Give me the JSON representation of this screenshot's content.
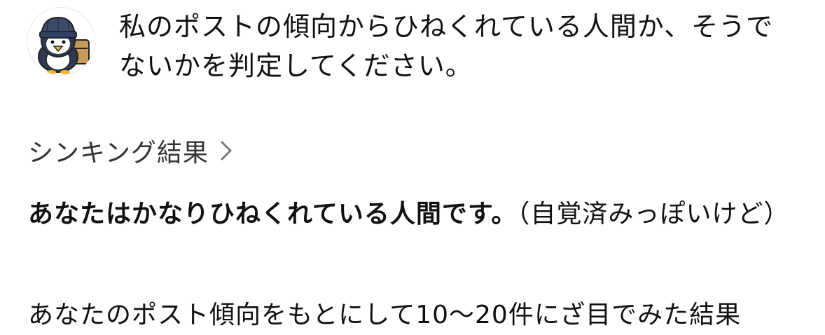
{
  "user": {
    "avatar_icon": "penguin-beanie-avatar-icon",
    "message": "私のポストの傾向からひねくれている人間か、そうでないかを判定してください。"
  },
  "thinking": {
    "label": "シンキング結果",
    "chevron_icon": "chevron-right-icon"
  },
  "answer": {
    "bold": "あなたはかなりひねくれている人間です。",
    "rest": "（自覚済みっぽいけど）",
    "next_line": "あなたのポスト傾向をもとにして10〜20件にざ目でみた結果"
  },
  "colors": {
    "text": "#111111",
    "muted": "#333333",
    "chevron": "#777777",
    "background": "#ffffff"
  }
}
